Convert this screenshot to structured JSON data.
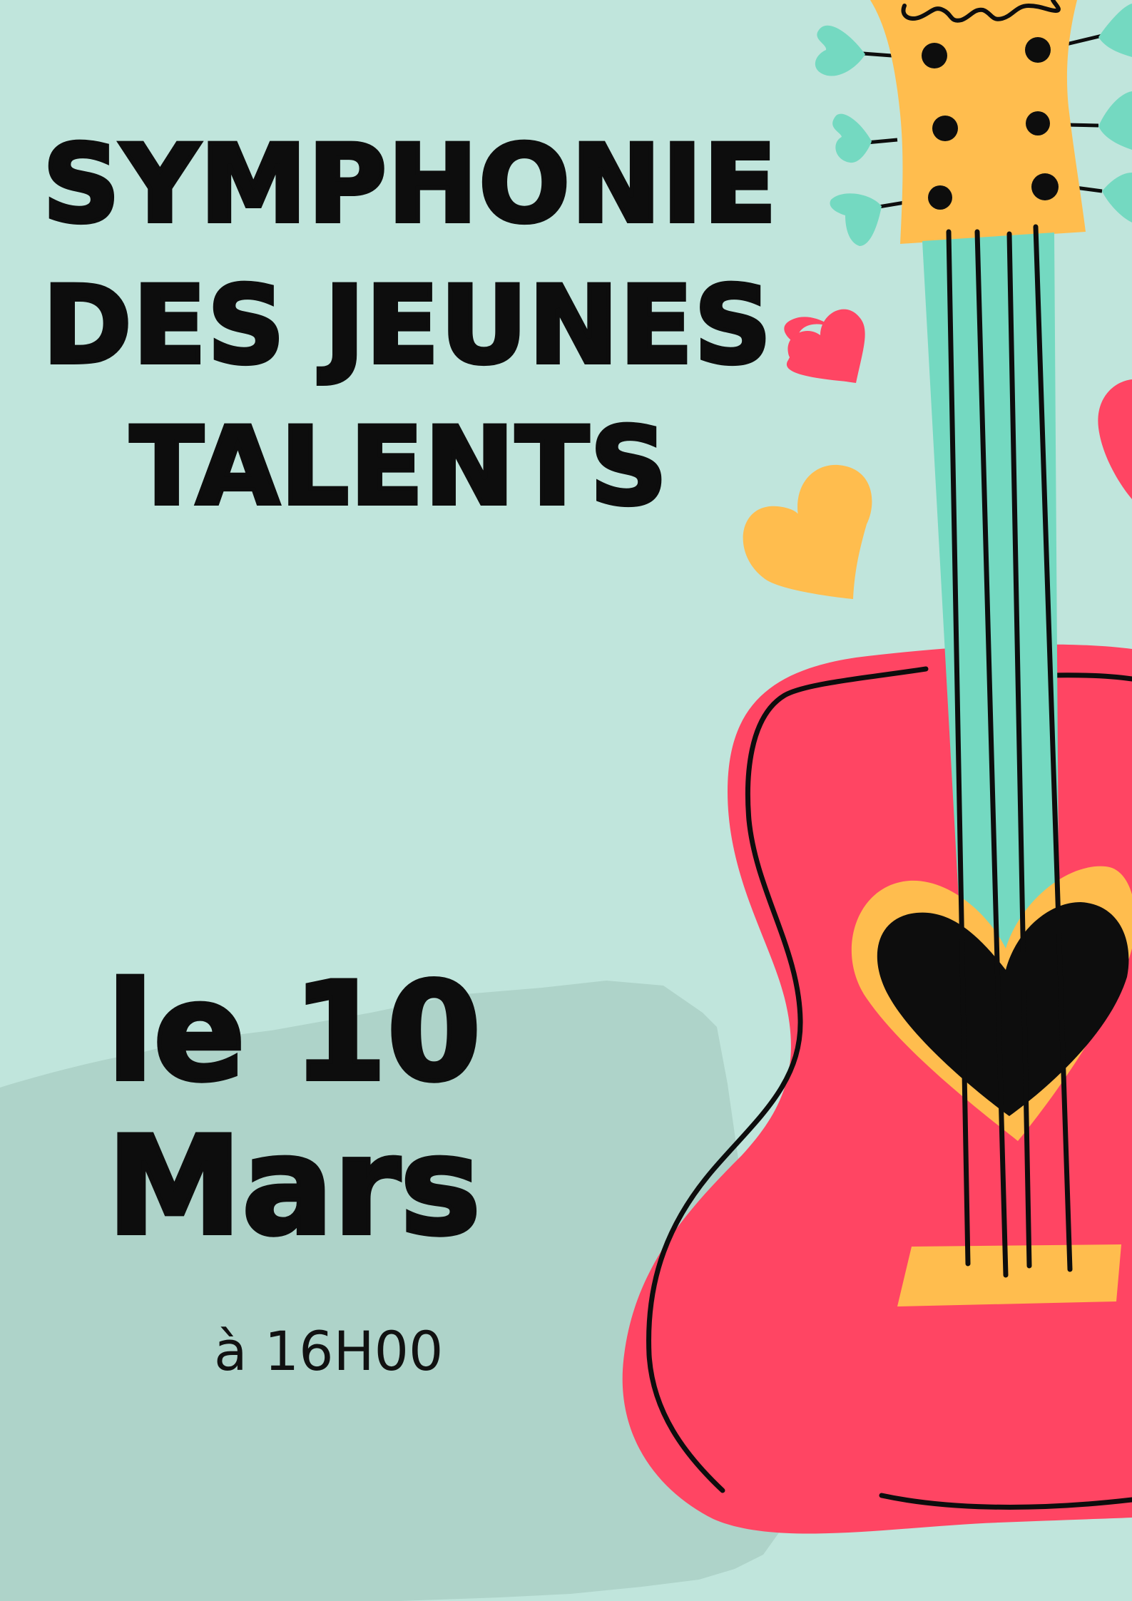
{
  "poster": {
    "title_lines": [
      "SYMPHONIE",
      "DES JEUNES",
      "TALENTS"
    ],
    "date_lines": [
      "le 10",
      "Mars"
    ],
    "time": "à 16H00"
  },
  "colors": {
    "background": "#c0e5dc",
    "brush": "#aed3c9",
    "guitar_body": "#ff4563",
    "accent_yellow": "#ffbd4e",
    "neck_teal": "#74d9c1",
    "ink": "#0d0d0d"
  },
  "icons": [
    "guitar-illustration",
    "heart-icon"
  ]
}
